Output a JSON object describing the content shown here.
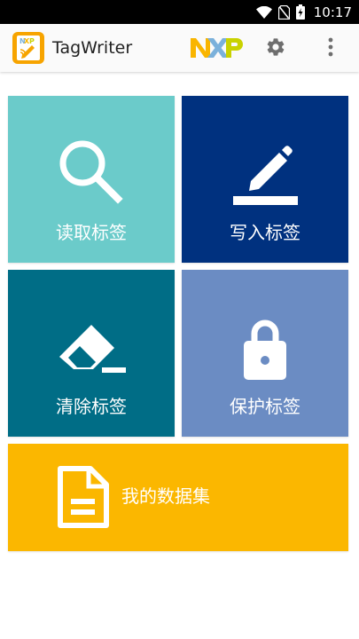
{
  "status_bar": {
    "time": "10:17",
    "icons": [
      "wifi-icon",
      "no-sim-icon",
      "battery-charging-icon"
    ]
  },
  "app_bar": {
    "title": "TagWriter",
    "logo_icon": "tagwriter-app-logo",
    "brand_logo": "nxp-logo",
    "actions": [
      "gear-icon",
      "more-vert-icon"
    ]
  },
  "tiles": {
    "read": {
      "label": "读取标签",
      "icon": "search-icon",
      "color": "#6bcbca"
    },
    "write": {
      "label": "写入标签",
      "icon": "pencil-icon",
      "color": "#00317f"
    },
    "erase": {
      "label": "清除标签",
      "icon": "eraser-icon",
      "color": "#006d86"
    },
    "protect": {
      "label": "保护标签",
      "icon": "lock-icon",
      "color": "#6b8cc3"
    },
    "datasets": {
      "label": "我的数据集",
      "icon": "document-icon",
      "color": "#fbb700"
    }
  },
  "colors": {
    "status_bar_bg": "#000000",
    "app_bar_bg": "#fafafa",
    "nxp_yellow": "#f9b500",
    "nxp_blue": "#7bb1db",
    "nxp_green": "#c9d200"
  }
}
